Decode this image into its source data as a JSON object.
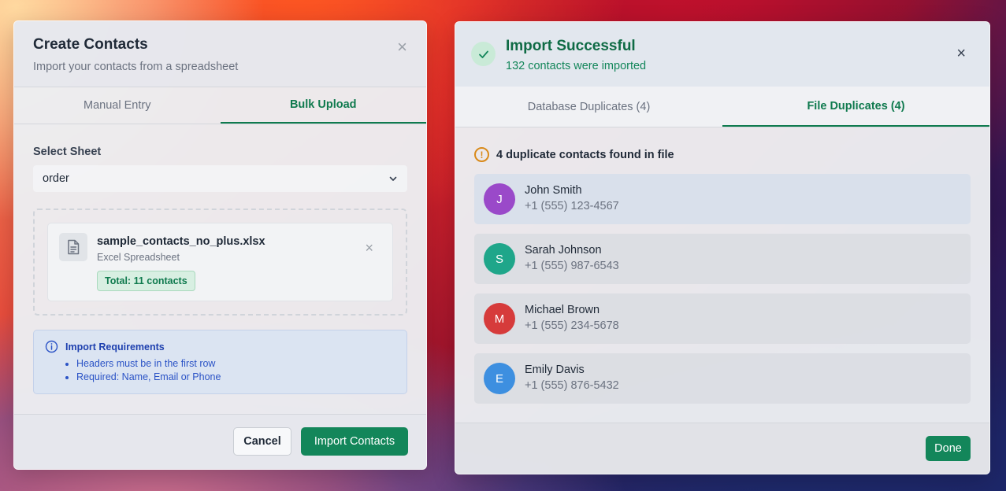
{
  "create_modal": {
    "title": "Create Contacts",
    "subtitle": "Import your contacts from a spreadsheet",
    "close_glyph": "×",
    "tabs": [
      {
        "label": "Manual Entry",
        "active": false
      },
      {
        "label": "Bulk Upload",
        "active": true
      }
    ],
    "sheet_label": "Select Sheet",
    "sheet_value": "order",
    "file": {
      "name": "sample_contacts_no_plus.xlsx",
      "type": "Excel Spreadsheet",
      "total": "Total: 11 contacts",
      "icon": "document-icon"
    },
    "requirements": {
      "title": "Import Requirements",
      "items": [
        "Headers must be in the first row",
        "Required: Name, Email or Phone"
      ]
    },
    "cancel_label": "Cancel",
    "import_label": "Import Contacts"
  },
  "result_modal": {
    "title": "Import Successful",
    "subtitle": "132 contacts were imported",
    "close_glyph": "×",
    "tabs": [
      {
        "label": "Database Duplicates (4)",
        "active": false
      },
      {
        "label": "File Duplicates (4)",
        "active": true
      }
    ],
    "warning_text": "4 duplicate contacts found in file",
    "warning_glyph": "!",
    "contacts": [
      {
        "initial": "J",
        "name": "John Smith",
        "phone": "+1 (555) 123-4567",
        "color": "#9a49c9"
      },
      {
        "initial": "S",
        "name": "Sarah Johnson",
        "phone": "+1 (555) 987-6543",
        "color": "#1fa68a"
      },
      {
        "initial": "M",
        "name": "Michael Brown",
        "phone": "+1 (555) 234-5678",
        "color": "#d63b3b"
      },
      {
        "initial": "E",
        "name": "Emily Davis",
        "phone": "+1 (555) 876-5432",
        "color": "#3d8fe0"
      }
    ],
    "done_label": "Done"
  },
  "colors": {
    "accent": "#13865a",
    "info_bg": "#dbe4f2",
    "warning": "#d98a1a"
  }
}
